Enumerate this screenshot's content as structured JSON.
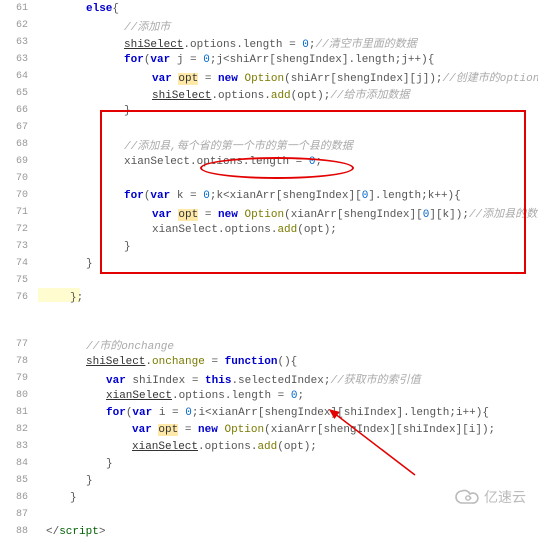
{
  "lines": [
    {
      "no": "61",
      "indent": 52,
      "segs": [
        {
          "c": "kw",
          "t": "else"
        },
        {
          "c": "def",
          "t": "{"
        }
      ]
    },
    {
      "no": "62",
      "indent": 90,
      "segs": [
        {
          "c": "com",
          "t": "//添加市"
        }
      ]
    },
    {
      "no": "63",
      "indent": 90,
      "segs": [
        {
          "c": "under",
          "t": "shiSelect"
        },
        {
          "c": "def",
          "t": "."
        },
        {
          "c": "prop",
          "t": "options"
        },
        {
          "c": "def",
          "t": "."
        },
        {
          "c": "prop",
          "t": "length"
        },
        {
          "c": "def",
          "t": " = "
        },
        {
          "c": "num",
          "t": "0"
        },
        {
          "c": "def",
          "t": ";"
        },
        {
          "c": "com",
          "t": "//清空市里面的数据"
        }
      ]
    },
    {
      "no": "63",
      "dup": true,
      "indent": 90,
      "segs": [
        {
          "c": "kw",
          "t": "for"
        },
        {
          "c": "def",
          "t": "("
        },
        {
          "c": "kw",
          "t": "var"
        },
        {
          "c": "def",
          "t": " j = "
        },
        {
          "c": "num",
          "t": "0"
        },
        {
          "c": "def",
          "t": ";j<"
        },
        {
          "c": "prop",
          "t": "shiArr"
        },
        {
          "c": "def",
          "t": "["
        },
        {
          "c": "prop",
          "t": "shengIndex"
        },
        {
          "c": "def",
          "t": "]."
        },
        {
          "c": "prop",
          "t": "length"
        },
        {
          "c": "def",
          "t": ";j++){"
        }
      ]
    },
    {
      "no": "64",
      "indent": 118,
      "segs": [
        {
          "c": "kw",
          "t": "var"
        },
        {
          "c": "def",
          "t": " "
        },
        {
          "c": "opt-hl",
          "t": "opt"
        },
        {
          "c": "def",
          "t": " = "
        },
        {
          "c": "kw",
          "t": "new"
        },
        {
          "c": "def",
          "t": " "
        },
        {
          "c": "fn",
          "t": "Option"
        },
        {
          "c": "def",
          "t": "("
        },
        {
          "c": "prop",
          "t": "shiArr"
        },
        {
          "c": "def",
          "t": "["
        },
        {
          "c": "prop",
          "t": "shengIndex"
        },
        {
          "c": "def",
          "t": "][j]);"
        },
        {
          "c": "com",
          "t": "//创建市的option选项"
        }
      ]
    },
    {
      "no": "65",
      "indent": 118,
      "segs": [
        {
          "c": "under",
          "t": "shiSelect"
        },
        {
          "c": "def",
          "t": "."
        },
        {
          "c": "prop",
          "t": "options"
        },
        {
          "c": "def",
          "t": "."
        },
        {
          "c": "fn",
          "t": "add"
        },
        {
          "c": "def",
          "t": "("
        },
        {
          "c": "prop",
          "t": "opt"
        },
        {
          "c": "def",
          "t": ");"
        },
        {
          "c": "com",
          "t": "//给市添加数据"
        }
      ]
    },
    {
      "no": "66",
      "indent": 90,
      "segs": [
        {
          "c": "def",
          "t": "}"
        }
      ]
    },
    {
      "no": "67",
      "indent": 90,
      "segs": []
    },
    {
      "no": "68",
      "indent": 90,
      "segs": [
        {
          "c": "com",
          "t": "//添加县,每个省的第一个市的第一个县的数据"
        }
      ]
    },
    {
      "no": "69",
      "indent": 90,
      "segs": [
        {
          "c": "prop",
          "t": "xianSelect"
        },
        {
          "c": "def",
          "t": "."
        },
        {
          "c": "prop",
          "t": "options"
        },
        {
          "c": "def",
          "t": "."
        },
        {
          "c": "prop",
          "t": "length"
        },
        {
          "c": "def",
          "t": " = "
        },
        {
          "c": "num",
          "t": "0"
        },
        {
          "c": "def",
          "t": ";"
        }
      ]
    },
    {
      "no": "70",
      "indent": 90,
      "segs": []
    },
    {
      "no": "70",
      "dup": true,
      "indent": 90,
      "segs": [
        {
          "c": "kw",
          "t": "for"
        },
        {
          "c": "def",
          "t": "("
        },
        {
          "c": "kw",
          "t": "var"
        },
        {
          "c": "def",
          "t": " k = "
        },
        {
          "c": "num",
          "t": "0"
        },
        {
          "c": "def",
          "t": ";k<"
        },
        {
          "c": "prop",
          "t": "xianArr"
        },
        {
          "c": "def",
          "t": "["
        },
        {
          "c": "prop",
          "t": "shengIndex"
        },
        {
          "c": "def",
          "t": "]["
        },
        {
          "c": "num",
          "t": "0"
        },
        {
          "c": "def",
          "t": "]."
        },
        {
          "c": "prop",
          "t": "length"
        },
        {
          "c": "def",
          "t": ";k++){"
        }
      ]
    },
    {
      "no": "71",
      "indent": 118,
      "segs": [
        {
          "c": "kw",
          "t": "var"
        },
        {
          "c": "def",
          "t": " "
        },
        {
          "c": "opt-hl",
          "t": "opt"
        },
        {
          "c": "def",
          "t": " = "
        },
        {
          "c": "kw",
          "t": "new"
        },
        {
          "c": "def",
          "t": " "
        },
        {
          "c": "fn",
          "t": "Option"
        },
        {
          "c": "def",
          "t": "("
        },
        {
          "c": "prop",
          "t": "xianArr"
        },
        {
          "c": "def",
          "t": "["
        },
        {
          "c": "prop",
          "t": "shengIndex"
        },
        {
          "c": "def",
          "t": "]["
        },
        {
          "c": "num",
          "t": "0"
        },
        {
          "c": "def",
          "t": "][k]);"
        },
        {
          "c": "com",
          "t": "//添加县的数据"
        }
      ]
    },
    {
      "no": "72",
      "indent": 118,
      "segs": [
        {
          "c": "prop",
          "t": "xianSelect"
        },
        {
          "c": "def",
          "t": "."
        },
        {
          "c": "prop",
          "t": "options"
        },
        {
          "c": "def",
          "t": "."
        },
        {
          "c": "fn",
          "t": "add"
        },
        {
          "c": "def",
          "t": "("
        },
        {
          "c": "prop",
          "t": "opt"
        },
        {
          "c": "def",
          "t": ");"
        }
      ]
    },
    {
      "no": "73",
      "indent": 90,
      "segs": [
        {
          "c": "def",
          "t": "}"
        }
      ]
    },
    {
      "no": "74",
      "indent": 52,
      "segs": [
        {
          "c": "def",
          "t": "}"
        }
      ]
    },
    {
      "no": "75",
      "indent": 52,
      "segs": []
    },
    {
      "no": "76",
      "indent": 36,
      "hl": true,
      "segs": [
        {
          "c": "def",
          "t": "};"
        }
      ]
    },
    {
      "no": "77",
      "indent": 52,
      "gap": true,
      "segs": [
        {
          "c": "com",
          "t": "//市的onchange"
        }
      ]
    },
    {
      "no": "78",
      "indent": 52,
      "segs": [
        {
          "c": "under",
          "t": "shiSelect"
        },
        {
          "c": "def",
          "t": "."
        },
        {
          "c": "fn",
          "t": "onchange"
        },
        {
          "c": "def",
          "t": " = "
        },
        {
          "c": "kw",
          "t": "function"
        },
        {
          "c": "def",
          "t": "(){"
        }
      ]
    },
    {
      "no": "79",
      "indent": 72,
      "segs": [
        {
          "c": "kw",
          "t": "var"
        },
        {
          "c": "def",
          "t": " shiIndex = "
        },
        {
          "c": "kw",
          "t": "this"
        },
        {
          "c": "def",
          "t": "."
        },
        {
          "c": "prop",
          "t": "selectedIndex"
        },
        {
          "c": "def",
          "t": ";"
        },
        {
          "c": "com",
          "t": "//获取市的索引值"
        }
      ]
    },
    {
      "no": "80",
      "indent": 72,
      "segs": [
        {
          "c": "under",
          "t": "xianSelect"
        },
        {
          "c": "def",
          "t": "."
        },
        {
          "c": "prop",
          "t": "options"
        },
        {
          "c": "def",
          "t": "."
        },
        {
          "c": "prop",
          "t": "length"
        },
        {
          "c": "def",
          "t": " = "
        },
        {
          "c": "num",
          "t": "0"
        },
        {
          "c": "def",
          "t": ";"
        }
      ]
    },
    {
      "no": "81",
      "indent": 72,
      "segs": [
        {
          "c": "kw",
          "t": "for"
        },
        {
          "c": "def",
          "t": "("
        },
        {
          "c": "kw",
          "t": "var"
        },
        {
          "c": "def",
          "t": " i = "
        },
        {
          "c": "num",
          "t": "0"
        },
        {
          "c": "def",
          "t": ";i<"
        },
        {
          "c": "prop",
          "t": "xianArr"
        },
        {
          "c": "def",
          "t": "["
        },
        {
          "c": "prop",
          "t": "shengIndex"
        },
        {
          "c": "def",
          "t": "]["
        },
        {
          "c": "prop",
          "t": "shiIndex"
        },
        {
          "c": "def",
          "t": "]."
        },
        {
          "c": "prop",
          "t": "length"
        },
        {
          "c": "def",
          "t": ";i++){"
        }
      ]
    },
    {
      "no": "82",
      "indent": 98,
      "segs": [
        {
          "c": "kw",
          "t": "var"
        },
        {
          "c": "def",
          "t": " "
        },
        {
          "c": "opt-hl",
          "t": "opt"
        },
        {
          "c": "def",
          "t": " = "
        },
        {
          "c": "kw",
          "t": "new"
        },
        {
          "c": "def",
          "t": " "
        },
        {
          "c": "fn",
          "t": "Option"
        },
        {
          "c": "def",
          "t": "("
        },
        {
          "c": "prop",
          "t": "xianArr"
        },
        {
          "c": "def",
          "t": "["
        },
        {
          "c": "prop",
          "t": "shengIndex"
        },
        {
          "c": "def",
          "t": "]["
        },
        {
          "c": "prop",
          "t": "shiIndex"
        },
        {
          "c": "def",
          "t": "][i]);"
        }
      ]
    },
    {
      "no": "83",
      "indent": 98,
      "segs": [
        {
          "c": "under",
          "t": "xianSelect"
        },
        {
          "c": "def",
          "t": "."
        },
        {
          "c": "prop",
          "t": "options"
        },
        {
          "c": "def",
          "t": "."
        },
        {
          "c": "fn",
          "t": "add"
        },
        {
          "c": "def",
          "t": "("
        },
        {
          "c": "prop",
          "t": "opt"
        },
        {
          "c": "def",
          "t": ");"
        }
      ]
    },
    {
      "no": "84",
      "indent": 72,
      "segs": [
        {
          "c": "def",
          "t": "}"
        }
      ]
    },
    {
      "no": "85",
      "indent": 52,
      "segs": [
        {
          "c": "def",
          "t": "}"
        }
      ]
    },
    {
      "no": "86",
      "indent": 36,
      "segs": [
        {
          "c": "def",
          "t": "}"
        }
      ]
    },
    {
      "no": "87",
      "indent": 36,
      "segs": []
    },
    {
      "no": "88",
      "indent": 12,
      "segs": [
        {
          "c": "def",
          "t": "</"
        },
        {
          "c": "tag",
          "t": "script"
        },
        {
          "c": "def",
          "t": ">"
        }
      ]
    }
  ],
  "logo_text": "亿速云"
}
